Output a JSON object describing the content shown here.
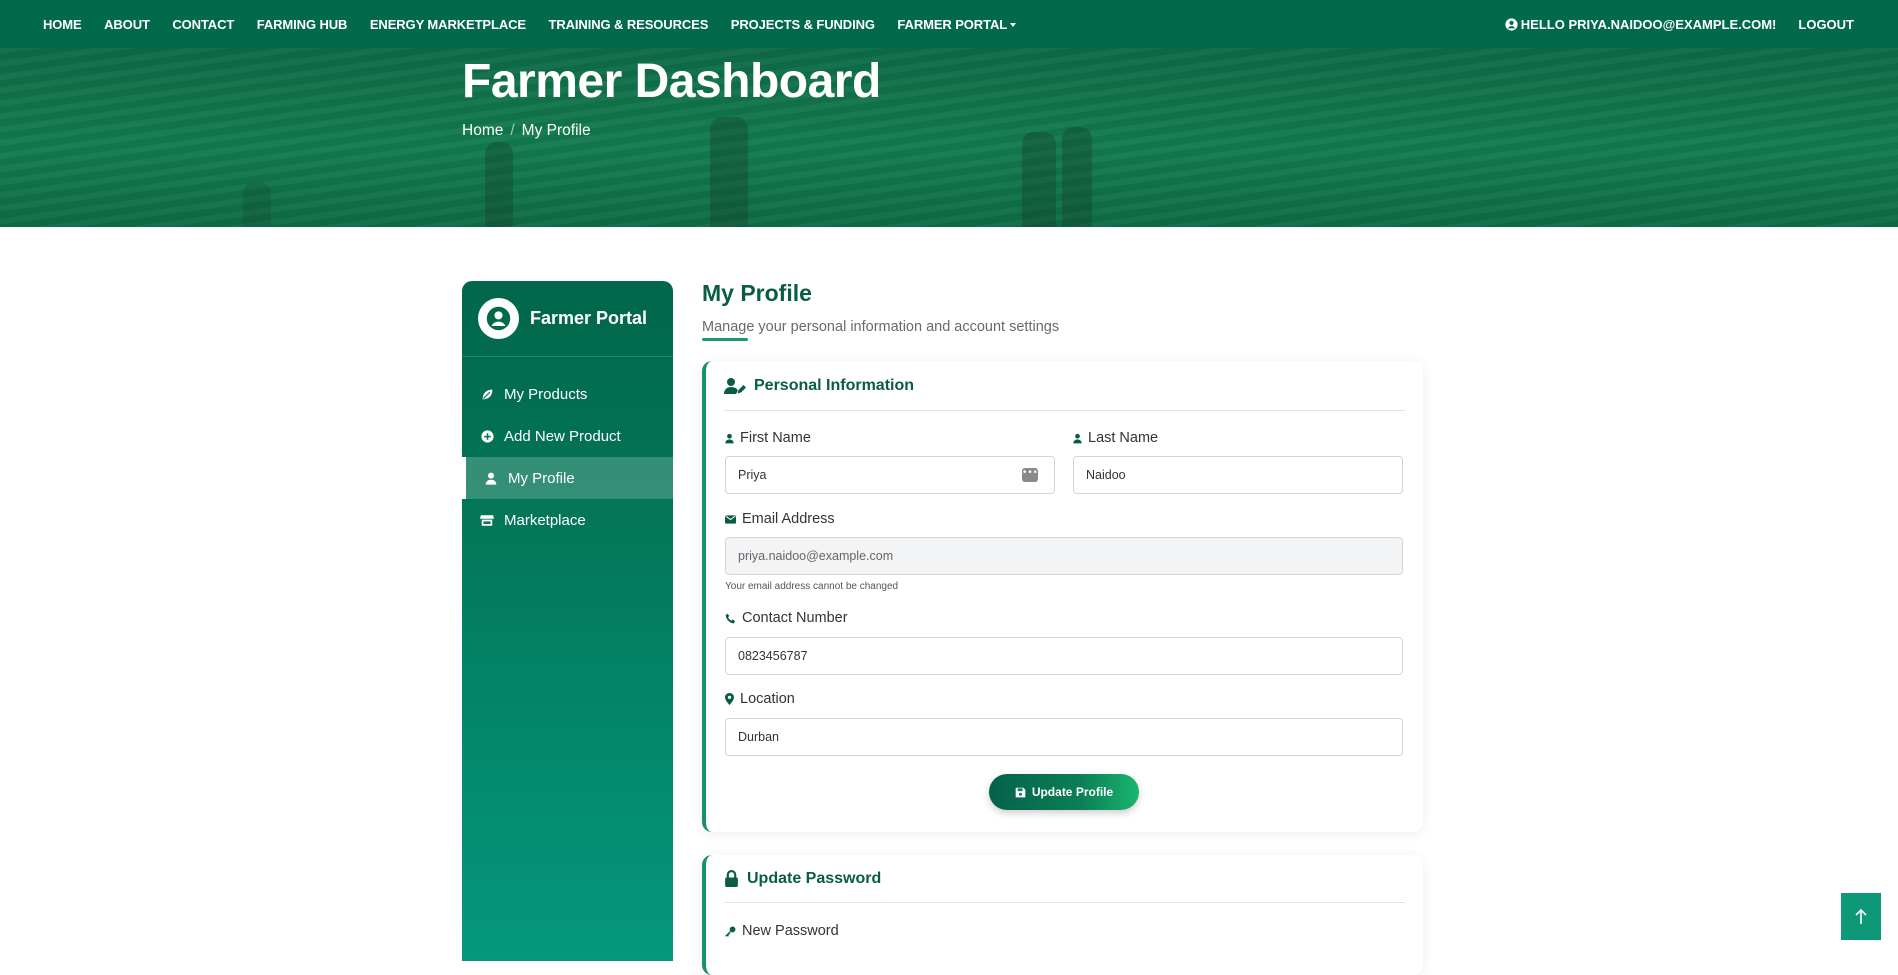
{
  "nav": {
    "links": [
      "HOME",
      "ABOUT",
      "CONTACT",
      "FARMING HUB",
      "ENERGY MARKETPLACE",
      "TRAINING & RESOURCES",
      "PROJECTS & FUNDING",
      "FARMER PORTAL"
    ],
    "greeting": "HELLO PRIYA.NAIDOO@EXAMPLE.COM!",
    "logout": "LOGOUT"
  },
  "hero": {
    "title": "Farmer Dashboard",
    "breadcrumb": [
      "Home",
      "My Profile"
    ],
    "breadcrumb_separator": "/"
  },
  "sidebar": {
    "title": "Farmer Portal",
    "items": [
      {
        "label": "My Products",
        "icon": "leaf-icon",
        "active": false
      },
      {
        "label": "Add New Product",
        "icon": "plus-circle-icon",
        "active": false
      },
      {
        "label": "My Profile",
        "icon": "user-icon",
        "active": true
      },
      {
        "label": "Marketplace",
        "icon": "store-icon",
        "active": false
      }
    ]
  },
  "main": {
    "title": "My Profile",
    "subtitle": "Manage your personal information and account settings"
  },
  "personal": {
    "heading": "Personal Information",
    "first_name_label": "First Name",
    "first_name_value": "Priya",
    "last_name_label": "Last Name",
    "last_name_value": "Naidoo",
    "email_label": "Email Address",
    "email_value": "priya.naidoo@example.com",
    "email_help": "Your email address cannot be changed",
    "contact_label": "Contact Number",
    "contact_value": "0823456787",
    "location_label": "Location",
    "location_value": "Durban",
    "submit": "Update Profile"
  },
  "password": {
    "heading": "Update Password",
    "new_password_label": "New Password"
  },
  "colors": {
    "brand_dark": "#026a4a",
    "accent": "#17935f"
  }
}
